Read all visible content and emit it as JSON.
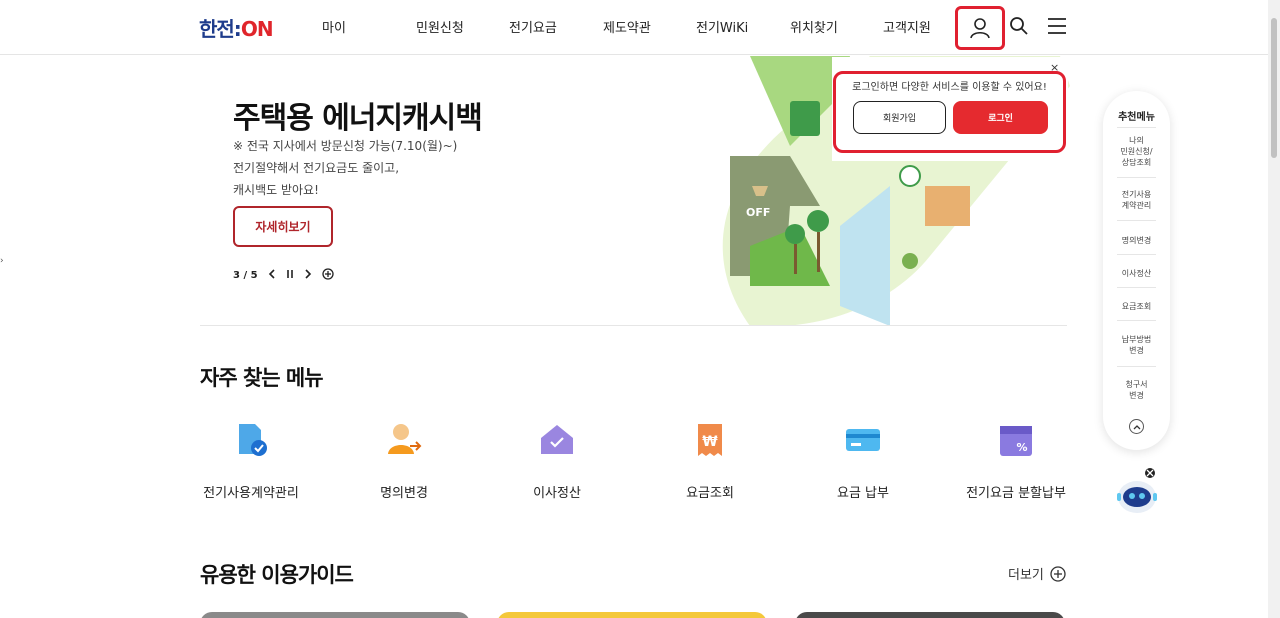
{
  "header": {
    "logo_part1": "한전:",
    "logo_part2": "ON",
    "nav": [
      "마이",
      "민원신청",
      "전기요금",
      "제도약관",
      "전기WiKi",
      "위치찾기",
      "고객지원"
    ],
    "icons": [
      "user-icon",
      "search-icon",
      "hamburger-menu-icon"
    ]
  },
  "hero": {
    "title": "주택용 에너지캐시백",
    "desc_line1": "※ 전국 지사에서 방문신청 가능(7.10(월)~)",
    "desc_line2": "전기절약해서 전기요금도 줄이고,",
    "desc_line3": "캐시백도 받아요!",
    "detail_label": "자세히보기",
    "pager_text": "3 / 5",
    "illus_label": "OFF"
  },
  "popup": {
    "message": "로그인하면 다양한 서비스를 이용할 수 있어요!",
    "join_label": "회원가입",
    "login_label": "로그인",
    "close": "×"
  },
  "quick_menu": {
    "title": "추천메뉴",
    "items": [
      [
        "나의",
        "민원신청/",
        "상담조회"
      ],
      [
        "전기사용",
        "계약관리"
      ],
      [
        "명의변경"
      ],
      [
        "이사정산"
      ],
      [
        "요금조회"
      ],
      [
        "납부방법",
        "변경"
      ],
      [
        "청구서",
        "변경"
      ]
    ]
  },
  "frequent": {
    "title": "자주 찾는 메뉴",
    "items": [
      {
        "label": "전기사용계약관리",
        "icon": "document-check-icon"
      },
      {
        "label": "명의변경",
        "icon": "person-change-icon"
      },
      {
        "label": "이사정산",
        "icon": "house-check-icon"
      },
      {
        "label": "요금조회",
        "icon": "won-receipt-icon"
      },
      {
        "label": "요금 납부",
        "icon": "card-icon"
      },
      {
        "label": "전기요금 분할납부",
        "icon": "calendar-percent-icon"
      }
    ]
  },
  "guide": {
    "title": "유용한 이용가이드",
    "more_label": "더보기"
  },
  "colors": {
    "brand_red": "#e52a2f",
    "brand_blue": "#1e3c8c",
    "highlight": "#e02030"
  }
}
